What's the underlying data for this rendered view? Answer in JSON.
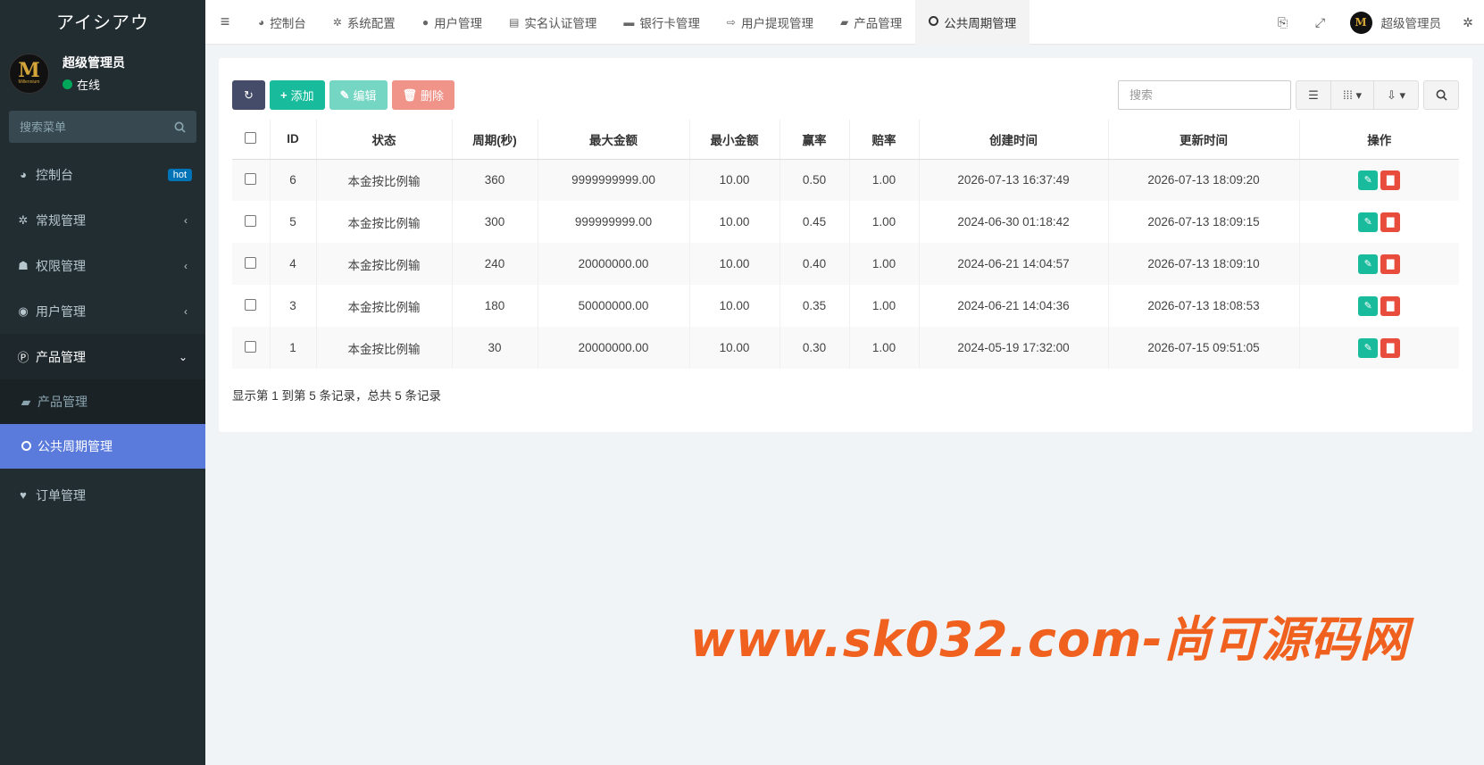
{
  "brand": "アイシアウ",
  "user": {
    "name": "超级管理员",
    "status": "在线",
    "avatar_letter": "M",
    "avatar_subtext": "Millennium"
  },
  "sidebar": {
    "search_placeholder": "搜索菜单",
    "items": [
      {
        "label": "控制台",
        "icon": "dashboard-icon",
        "badge": "hot"
      },
      {
        "label": "常规管理",
        "icon": "cogs-icon"
      },
      {
        "label": "权限管理",
        "icon": "group-icon"
      },
      {
        "label": "用户管理",
        "icon": "user-circle-icon"
      },
      {
        "label": "产品管理",
        "icon": "product-icon",
        "open": true
      },
      {
        "label": "订单管理",
        "icon": "heartbeat-icon"
      }
    ],
    "subitems": [
      {
        "label": "产品管理",
        "icon": "shopping-bag-icon"
      },
      {
        "label": "公共周期管理",
        "icon": "circle-icon",
        "active": true
      }
    ]
  },
  "header": {
    "tabs": [
      {
        "label": "控制台",
        "icon": "dashboard-icon"
      },
      {
        "label": "系统配置",
        "icon": "gear-icon"
      },
      {
        "label": "用户管理",
        "icon": "user-icon"
      },
      {
        "label": "实名认证管理",
        "icon": "id-card-icon"
      },
      {
        "label": "银行卡管理",
        "icon": "credit-card-icon"
      },
      {
        "label": "用户提现管理",
        "icon": "sign-out-icon"
      },
      {
        "label": "产品管理",
        "icon": "shopping-bag-icon"
      },
      {
        "label": "公共周期管理",
        "icon": "circle-icon",
        "active": true
      }
    ],
    "user_name": "超级管理员"
  },
  "toolbar": {
    "add": "添加",
    "edit": "编辑",
    "delete": "删除",
    "search_placeholder": "搜索"
  },
  "table": {
    "columns": [
      "ID",
      "状态",
      "周期(秒)",
      "最大金额",
      "最小金额",
      "赢率",
      "赔率",
      "创建时间",
      "更新时间",
      "操作"
    ],
    "rows": [
      {
        "id": "6",
        "status": "本金按比例输",
        "period": "360",
        "max": "9999999999.00",
        "min": "10.00",
        "win": "0.50",
        "odds": "1.00",
        "created": "2026-07-13 16:37:49",
        "updated": "2026-07-13 18:09:20"
      },
      {
        "id": "5",
        "status": "本金按比例输",
        "period": "300",
        "max": "999999999.00",
        "min": "10.00",
        "win": "0.45",
        "odds": "1.00",
        "created": "2024-06-30 01:18:42",
        "updated": "2026-07-13 18:09:15"
      },
      {
        "id": "4",
        "status": "本金按比例输",
        "period": "240",
        "max": "20000000.00",
        "min": "10.00",
        "win": "0.40",
        "odds": "1.00",
        "created": "2024-06-21 14:04:57",
        "updated": "2026-07-13 18:09:10"
      },
      {
        "id": "3",
        "status": "本金按比例输",
        "period": "180",
        "max": "50000000.00",
        "min": "10.00",
        "win": "0.35",
        "odds": "1.00",
        "created": "2024-06-21 14:04:36",
        "updated": "2026-07-13 18:08:53"
      },
      {
        "id": "1",
        "status": "本金按比例输",
        "period": "30",
        "max": "20000000.00",
        "min": "10.00",
        "win": "0.30",
        "odds": "1.00",
        "created": "2024-05-19 17:32:00",
        "updated": "2026-07-15 09:51:05"
      }
    ]
  },
  "pagination_info": "显示第 1 到第 5 条记录，总共 5 条记录",
  "watermark": "www.sk032.com-尚可源码网",
  "colors": {
    "sidebar_bg": "#222d32",
    "active_blue": "#5b7bdc",
    "success": "#18bc9c",
    "danger": "#e74c3c",
    "watermark": "#f0601e"
  }
}
